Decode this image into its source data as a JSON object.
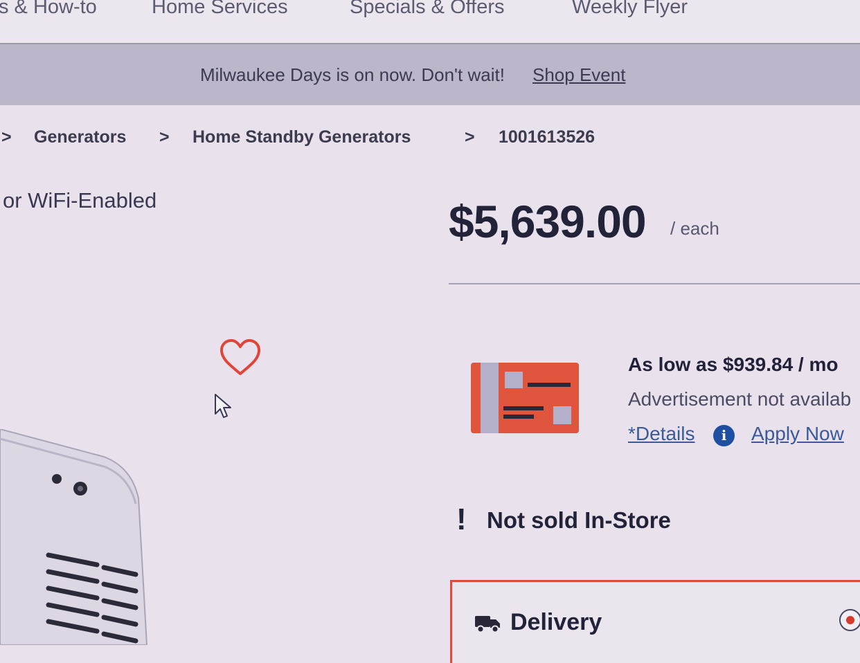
{
  "nav": {
    "items": [
      "s & How-to",
      "Home Services",
      "Specials & Offers",
      "Weekly Flyer"
    ]
  },
  "banner": {
    "text": "Milwaukee Days is on now. Don't wait!",
    "link": "Shop Event"
  },
  "breadcrumb": {
    "separator": ">",
    "items": [
      "Generators",
      "Home Standby Generators",
      "1001613526"
    ]
  },
  "product": {
    "title_fragment": "or WiFi-Enabled",
    "price": "$5,639.00",
    "unit": "/ each"
  },
  "financing": {
    "as_low_as": "As low as $939.84 / mo",
    "ad_notice": "Advertisement not availab",
    "details_link": "*Details",
    "info_icon_glyph": "i",
    "apply_link": "Apply Now"
  },
  "availability": {
    "exclamation": "!",
    "text": "Not sold In-Store"
  },
  "fulfillment": {
    "delivery_label": "Delivery"
  },
  "colors": {
    "accent_red": "#e04a3a",
    "card_orange": "#e0553e",
    "link_blue": "#3b5a9a",
    "info_blue": "#1f4fa0"
  },
  "icons": [
    "heart-icon",
    "cursor-icon",
    "credit-card-icon",
    "info-icon",
    "truck-icon"
  ]
}
